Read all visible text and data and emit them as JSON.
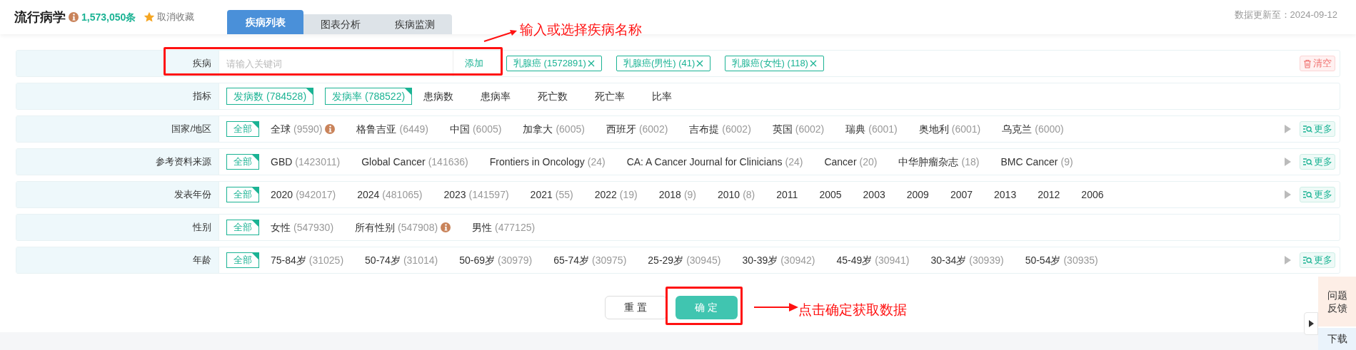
{
  "header": {
    "title": "流行病学",
    "count": "1,573,050条",
    "favorite": {
      "label": "取消收藏",
      "on": true
    },
    "tabs": [
      {
        "label": "疾病列表",
        "selected": true
      },
      {
        "label": "图表分析",
        "selected": false
      },
      {
        "label": "疾病监测",
        "selected": false
      }
    ],
    "updated": "数据更新至：2024-09-12"
  },
  "disease": {
    "label": "疾病",
    "placeholder": "请输入关键词",
    "add": "添加",
    "tags": [
      {
        "label": "乳腺癌 (1572891)"
      },
      {
        "label": "乳腺癌(男性) (41)"
      },
      {
        "label": "乳腺癌(女性) (118)"
      }
    ],
    "clear": "清空"
  },
  "rows": [
    {
      "label": "指标",
      "kind": "indicator",
      "options": [
        {
          "name": "发病数",
          "count": "(784528)",
          "selected": true
        },
        {
          "name": "发病率",
          "count": "(788522)",
          "selected": true
        },
        {
          "name": "患病数",
          "selected": false
        },
        {
          "name": "患病率",
          "selected": false
        },
        {
          "name": "死亡数",
          "selected": false
        },
        {
          "name": "死亡率",
          "selected": false
        },
        {
          "name": "比率",
          "selected": false
        }
      ]
    },
    {
      "label": "国家/地区",
      "kind": "options",
      "all": {
        "label": "全部",
        "selected": true
      },
      "more": "更多",
      "options": [
        {
          "name": "全球",
          "count": "(9590)",
          "info": true
        },
        {
          "name": "格鲁吉亚",
          "count": "(6449)"
        },
        {
          "name": "中国",
          "count": "(6005)"
        },
        {
          "name": "加拿大",
          "count": "(6005)"
        },
        {
          "name": "西班牙",
          "count": "(6002)"
        },
        {
          "name": "吉布提",
          "count": "(6002)"
        },
        {
          "name": "英国",
          "count": "(6002)"
        },
        {
          "name": "瑞典",
          "count": "(6001)"
        },
        {
          "name": "奥地利",
          "count": "(6001)"
        },
        {
          "name": "乌克兰",
          "count": "(6000)"
        }
      ]
    },
    {
      "label": "参考资料来源",
      "kind": "options",
      "all": {
        "label": "全部",
        "selected": true
      },
      "more": "更多",
      "options": [
        {
          "name": "GBD",
          "count": "(1423011)"
        },
        {
          "name": "Global Cancer",
          "count": "(141636)"
        },
        {
          "name": "Frontiers in Oncology",
          "count": "(24)"
        },
        {
          "name": "CA: A Cancer Journal for Clinicians",
          "count": "(24)"
        },
        {
          "name": "Cancer",
          "count": "(20)"
        },
        {
          "name": "中华肿瘤杂志",
          "count": "(18)"
        },
        {
          "name": "BMC Cancer",
          "count": "(9)"
        }
      ]
    },
    {
      "label": "发表年份",
      "kind": "options",
      "all": {
        "label": "全部",
        "selected": true
      },
      "more": "更多",
      "options": [
        {
          "name": "2020",
          "count": "(942017)"
        },
        {
          "name": "2024",
          "count": "(481065)"
        },
        {
          "name": "2023",
          "count": "(141597)"
        },
        {
          "name": "2021",
          "count": "(55)"
        },
        {
          "name": "2022",
          "count": "(19)"
        },
        {
          "name": "2018",
          "count": "(9)"
        },
        {
          "name": "2010",
          "count": "(8)"
        },
        {
          "name": "2011"
        },
        {
          "name": "2005"
        },
        {
          "name": "2003"
        },
        {
          "name": "2009"
        },
        {
          "name": "2007"
        },
        {
          "name": "2013"
        },
        {
          "name": "2012"
        },
        {
          "name": "2006"
        }
      ]
    },
    {
      "label": "性别",
      "kind": "options",
      "all": {
        "label": "全部",
        "selected": true
      },
      "options": [
        {
          "name": "女性",
          "count": "(547930)"
        },
        {
          "name": "所有性别",
          "count": "(547908)",
          "info": true
        },
        {
          "name": "男性",
          "count": "(477125)"
        }
      ]
    },
    {
      "label": "年龄",
      "kind": "options",
      "all": {
        "label": "全部",
        "selected": true
      },
      "more": "更多",
      "options": [
        {
          "name": "75-84岁",
          "count": "(31025)"
        },
        {
          "name": "50-74岁",
          "count": "(31014)"
        },
        {
          "name": "50-69岁",
          "count": "(30979)"
        },
        {
          "name": "65-74岁",
          "count": "(30975)"
        },
        {
          "name": "25-29岁",
          "count": "(30945)"
        },
        {
          "name": "30-39岁",
          "count": "(30942)"
        },
        {
          "name": "45-49岁",
          "count": "(30941)"
        },
        {
          "name": "30-34岁",
          "count": "(30939)"
        },
        {
          "name": "50-54岁",
          "count": "(30935)"
        }
      ]
    }
  ],
  "buttons": {
    "reset": "重 置",
    "confirm": "确 定"
  },
  "annotations": [
    "输入或选择疾病名称",
    "点击确定获取数据"
  ],
  "side": {
    "feedback": "问题反馈",
    "download": "下载"
  }
}
